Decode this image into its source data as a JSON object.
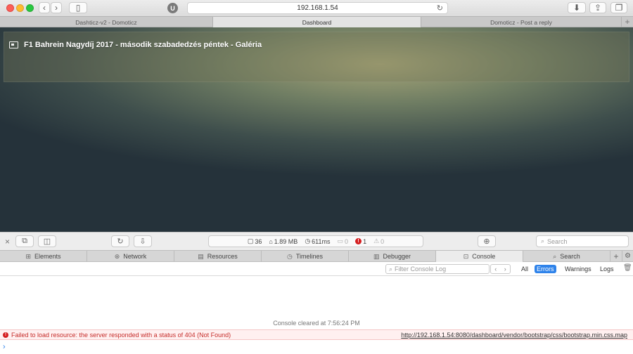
{
  "browser": {
    "url": "192.168.1.54",
    "extension_label": "U",
    "tabs": [
      {
        "label": "Dashticz-v2 - Domoticz",
        "active": false
      },
      {
        "label": "Dashboard",
        "active": true
      },
      {
        "label": "Domoticz - Post a reply",
        "active": false
      }
    ],
    "new_tab_label": "+"
  },
  "page": {
    "news_title": "F1 Bahrein Nagydíj 2017 - második szabadedzés péntek - Galéria",
    "background_colors": [
      "#a7a678",
      "#6f7d63",
      "#25323a"
    ]
  },
  "inspector": {
    "status": {
      "resources": "36",
      "size": "1.89 MB",
      "load_time": "611ms",
      "logs": "0",
      "errors": "1",
      "warnings": "0"
    },
    "search_placeholder": "Search",
    "tabs": [
      {
        "label": "Elements",
        "icon": "elements-icon",
        "active": false
      },
      {
        "label": "Network",
        "icon": "network-icon",
        "active": false
      },
      {
        "label": "Resources",
        "icon": "resources-icon",
        "active": false
      },
      {
        "label": "Timelines",
        "icon": "timelines-icon",
        "active": false
      },
      {
        "label": "Debugger",
        "icon": "debugger-icon",
        "active": false
      },
      {
        "label": "Console",
        "icon": "console-icon",
        "active": true
      },
      {
        "label": "Search",
        "icon": "search-icon",
        "active": false
      }
    ],
    "console": {
      "filter_placeholder": "Filter Console Log",
      "levels": {
        "all": "All",
        "errors": "Errors",
        "warnings": "Warnings",
        "logs": "Logs"
      },
      "active_level": "Errors",
      "cleared_message": "Console cleared at 7:56:24 PM",
      "error_message": "Failed to load resource: the server responded with a status of 404 (Not Found)",
      "error_url": "http://192.168.1.54:8080/dashboard/vendor/bootstrap/css/bootstrap.min.css.map",
      "prompt": "›"
    },
    "accent_color": "#2f83ea",
    "error_color": "#d51e20"
  }
}
